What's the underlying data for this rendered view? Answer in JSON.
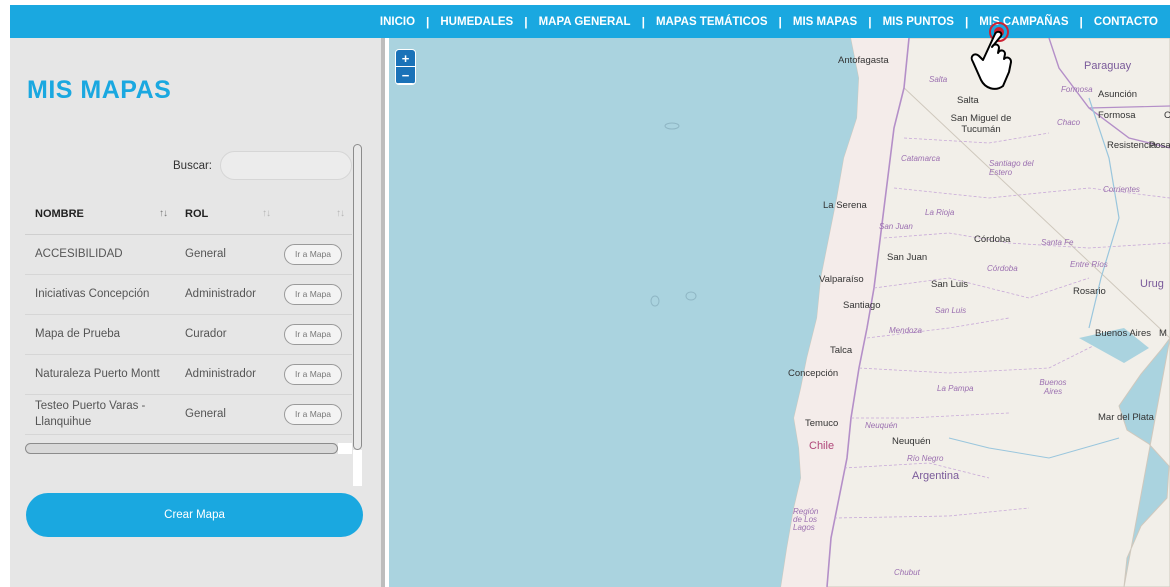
{
  "nav": {
    "items": [
      "INICIO",
      "HUMEDALES",
      "MAPA GENERAL",
      "MAPAS TEMÁTICOS",
      "MIS MAPAS",
      "MIS PUNTOS",
      "MIS CAMPAÑAS",
      "CONTACTO"
    ],
    "separator": "|"
  },
  "panel": {
    "title": "MIS MAPAS",
    "search_label": "Buscar:",
    "search_value": "",
    "columns": [
      "NOMBRE",
      "ROL",
      ""
    ],
    "sort_glyph": "↑↓",
    "rows": [
      {
        "name": "ACCESIBILIDAD",
        "rol": "General",
        "action": "Ir a Mapa"
      },
      {
        "name": "Iniciativas Concepción",
        "rol": "Administrador",
        "action": "Ir a Mapa"
      },
      {
        "name": "Mapa de Prueba",
        "rol": "Curador",
        "action": "Ir a Mapa"
      },
      {
        "name": "Naturaleza Puerto Montt",
        "rol": "Administrador",
        "action": "Ir a Mapa"
      },
      {
        "name": "Testeo Puerto Varas - Llanquihue",
        "rol": "General",
        "action": "Ir a Mapa"
      }
    ],
    "create_button": "Crear Mapa"
  },
  "map": {
    "zoom_in": "+",
    "zoom_out": "−",
    "colors": {
      "sea": "#aad3df",
      "land": "#f2efe9",
      "border": "#b48fc8"
    },
    "countries": [
      "Chile",
      "Argentina",
      "Paraguay"
    ],
    "cities": [
      "Antofagasta",
      "Salta",
      "Asunción",
      "Formosa",
      "San Miguel de Tucumán",
      "Resistencia",
      "Posadas",
      "La Serena",
      "Córdoba",
      "San Juan",
      "Valparaíso",
      "San Luis",
      "Rosario",
      "Santiago",
      "Buenos Aires",
      "Talca",
      "Concepción",
      "Mar del Plata",
      "Temuco",
      "Neuquén"
    ],
    "provinces": [
      "Salta",
      "Formosa",
      "Chaco",
      "Catamarca",
      "Santiago del Estero",
      "Corrientes",
      "La Rioja",
      "San Juan",
      "Santa Fe",
      "Córdoba",
      "Entre Ríos",
      "San Luis",
      "Mendoza",
      "La Pampa",
      "Buenos Aires",
      "Neuquén",
      "Río Negro",
      "Región de Los Lagos",
      "Chubut"
    ],
    "partial_labels": [
      "C",
      "Posad",
      "Urug",
      "M"
    ]
  }
}
